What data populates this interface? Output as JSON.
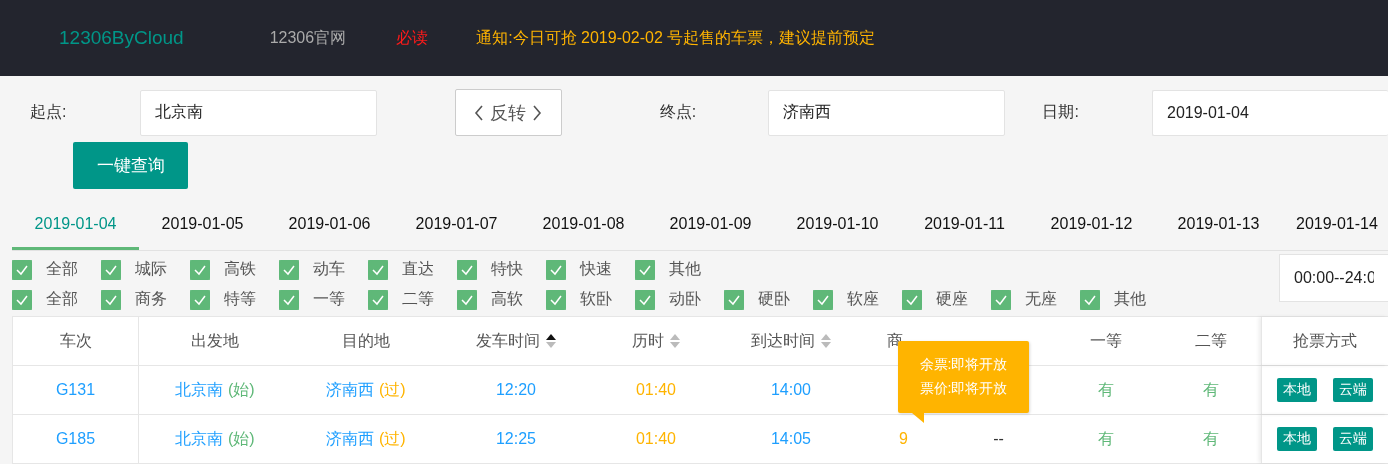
{
  "navbar": {
    "brand": "12306ByCloud",
    "links": [
      "12306官网"
    ],
    "must_read": "必读",
    "notice": "通知:今日可抢 2019-02-02 号起售的车票，建议提前预定"
  },
  "search": {
    "from_label": "起点:",
    "from_value": "北京南",
    "swap_button": "反转",
    "to_label": "终点:",
    "to_value": "济南西",
    "date_label": "日期:",
    "date_value": "2019-01-04",
    "query_button": "一键查询"
  },
  "date_tabs": [
    {
      "label": "2019-01-04",
      "selected": true
    },
    {
      "label": "2019-01-05",
      "selected": false
    },
    {
      "label": "2019-01-06",
      "selected": false
    },
    {
      "label": "2019-01-07",
      "selected": false
    },
    {
      "label": "2019-01-08",
      "selected": false
    },
    {
      "label": "2019-01-09",
      "selected": false
    },
    {
      "label": "2019-01-10",
      "selected": false
    },
    {
      "label": "2019-01-11",
      "selected": false
    },
    {
      "label": "2019-01-12",
      "selected": false
    },
    {
      "label": "2019-01-13",
      "selected": false
    },
    {
      "label": "2019-01-14",
      "selected": false
    }
  ],
  "train_filters": [
    {
      "label": "全部",
      "checked": true
    },
    {
      "label": "城际",
      "checked": true
    },
    {
      "label": "高铁",
      "checked": true
    },
    {
      "label": "动车",
      "checked": true
    },
    {
      "label": "直达",
      "checked": true
    },
    {
      "label": "特快",
      "checked": true
    },
    {
      "label": "快速",
      "checked": true
    },
    {
      "label": "其他",
      "checked": true
    }
  ],
  "seat_filters": [
    {
      "label": "全部",
      "checked": true
    },
    {
      "label": "商务",
      "checked": true
    },
    {
      "label": "特等",
      "checked": true
    },
    {
      "label": "一等",
      "checked": true
    },
    {
      "label": "二等",
      "checked": true
    },
    {
      "label": "高软",
      "checked": true
    },
    {
      "label": "软卧",
      "checked": true
    },
    {
      "label": "动卧",
      "checked": true
    },
    {
      "label": "硬卧",
      "checked": true
    },
    {
      "label": "软座",
      "checked": true
    },
    {
      "label": "硬座",
      "checked": true
    },
    {
      "label": "无座",
      "checked": true
    },
    {
      "label": "其他",
      "checked": true
    }
  ],
  "time_range": "00:00--24:0",
  "table": {
    "columns": [
      {
        "label": "车次"
      },
      {
        "label": "出发地"
      },
      {
        "label": "目的地"
      },
      {
        "label": "发车时间",
        "sorted": true
      },
      {
        "label": "历时",
        "sorted": false
      },
      {
        "label": "到达时间",
        "sorted": false
      },
      {
        "label": "商"
      },
      {},
      {
        "label": "一等"
      },
      {
        "label": "二等"
      },
      {
        "label": "抢票方式"
      }
    ],
    "rows": [
      {
        "train": "G131",
        "from": "北京南",
        "from_tag": "(始)",
        "to": "济南西",
        "to_tag": "(过)",
        "depart": "12:20",
        "duration": "01:40",
        "arrive": "14:00",
        "first": "有",
        "second": "有",
        "actions": [
          "本地",
          "云端"
        ]
      },
      {
        "train": "G185",
        "from": "北京南",
        "from_tag": "(始)",
        "to": "济南西",
        "to_tag": "(过)",
        "depart": "12:25",
        "duration": "01:40",
        "arrive": "14:05",
        "business": "9",
        "special": "--",
        "first": "有",
        "second": "有",
        "actions": [
          "本地",
          "云端"
        ]
      }
    ]
  },
  "tooltip": [
    "余票:即将开放",
    "票价:即将开放"
  ]
}
